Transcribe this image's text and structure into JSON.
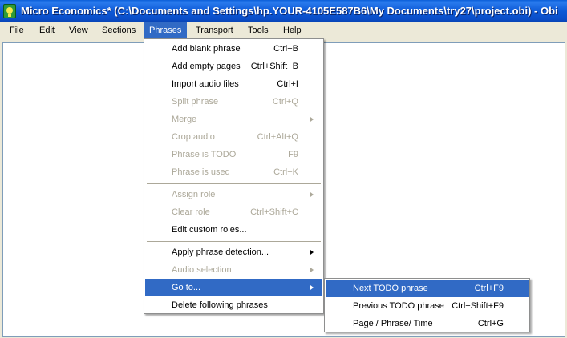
{
  "window": {
    "title": "Micro Economics* (C:\\Documents and Settings\\hp.YOUR-4105E587B6\\My Documents\\try27\\project.obi) - Obi",
    "icon": "obi-app-icon"
  },
  "menubar": [
    {
      "label": "File"
    },
    {
      "label": "Edit"
    },
    {
      "label": "View"
    },
    {
      "label": "Sections"
    },
    {
      "label": "Phrases"
    },
    {
      "label": "Transport"
    },
    {
      "label": "Tools"
    },
    {
      "label": "Help"
    }
  ],
  "phrases_menu": [
    {
      "label": "Add blank phrase",
      "shortcut": "Ctrl+B",
      "enabled": true
    },
    {
      "label": "Add empty pages",
      "shortcut": "Ctrl+Shift+B",
      "enabled": true
    },
    {
      "label": "Import audio files",
      "shortcut": "Ctrl+I",
      "enabled": true
    },
    {
      "label": "Split phrase",
      "shortcut": "Ctrl+Q",
      "enabled": false
    },
    {
      "label": "Merge",
      "shortcut": "",
      "enabled": false,
      "submenu": true
    },
    {
      "label": "Crop audio",
      "shortcut": "Ctrl+Alt+Q",
      "enabled": false
    },
    {
      "label": "Phrase is TODO",
      "shortcut": "F9",
      "enabled": false
    },
    {
      "label": "Phrase is used",
      "shortcut": "Ctrl+K",
      "enabled": false
    },
    {
      "label": "Assign role",
      "shortcut": "",
      "enabled": false,
      "submenu": true
    },
    {
      "label": "Clear role",
      "shortcut": "Ctrl+Shift+C",
      "enabled": false
    },
    {
      "label": "Edit custom roles...",
      "shortcut": "",
      "enabled": true
    },
    {
      "label": "Apply phrase detection...",
      "shortcut": "",
      "enabled": true,
      "submenu": true
    },
    {
      "label": "Audio selection",
      "shortcut": "",
      "enabled": false,
      "submenu": true
    },
    {
      "label": "Go to...",
      "shortcut": "",
      "enabled": true,
      "submenu": true
    },
    {
      "label": "Delete following phrases",
      "shortcut": "",
      "enabled": true
    }
  ],
  "goto_submenu": [
    {
      "label": "Next TODO phrase",
      "shortcut": "Ctrl+F9"
    },
    {
      "label": "Previous TODO phrase",
      "shortcut": "Ctrl+Shift+F9"
    },
    {
      "label": "Page / Phrase/ Time",
      "shortcut": "Ctrl+G"
    }
  ],
  "colors": {
    "highlight": "#316ac5",
    "disabled_text": "#aca899",
    "titlebar": "#0a5ed8"
  }
}
